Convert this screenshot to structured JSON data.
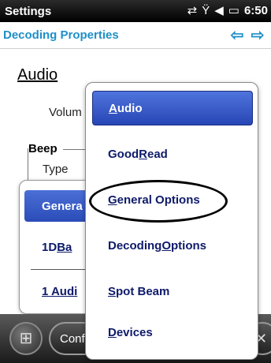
{
  "statusbar": {
    "title": "Settings",
    "icons": [
      "data-sync-icon",
      "signal-off-icon",
      "volume-icon",
      "battery-charging-icon"
    ],
    "time": "6:50"
  },
  "titlebar": {
    "title": "Decoding Properties",
    "back_icon": "arrow-left-icon",
    "forward_icon": "arrow-right-icon"
  },
  "page": {
    "section_heading": "Audio",
    "volume_label": "Volum",
    "group_beep": "Beep",
    "type_label": "Type"
  },
  "background_menu": {
    "items": [
      {
        "pre": "",
        "u": "",
        "post": "Genera",
        "selected": true
      },
      {
        "pre": "1D ",
        "u": "Ba",
        "post": "",
        "selected": false
      },
      {
        "pre": "",
        "u": "1 Audi",
        "post": "",
        "selected": false
      }
    ]
  },
  "menu": {
    "items": [
      {
        "pre": "",
        "u": "A",
        "post": "udio",
        "selected": true
      },
      {
        "pre": "Good ",
        "u": "R",
        "post": "ead",
        "selected": false
      },
      {
        "pre": "",
        "u": "G",
        "post": "eneral Options",
        "selected": false
      },
      {
        "pre": "Decoding ",
        "u": "O",
        "post": "ptions",
        "selected": false
      },
      {
        "pre": "",
        "u": "S",
        "post": "pot Beam",
        "selected": false
      },
      {
        "pre": "",
        "u": "D",
        "post": "evices",
        "selected": false
      }
    ]
  },
  "bottombar": {
    "start_icon": "windows-start-icon",
    "conf_label": "Conf",
    "close_icon": "close-icon"
  }
}
